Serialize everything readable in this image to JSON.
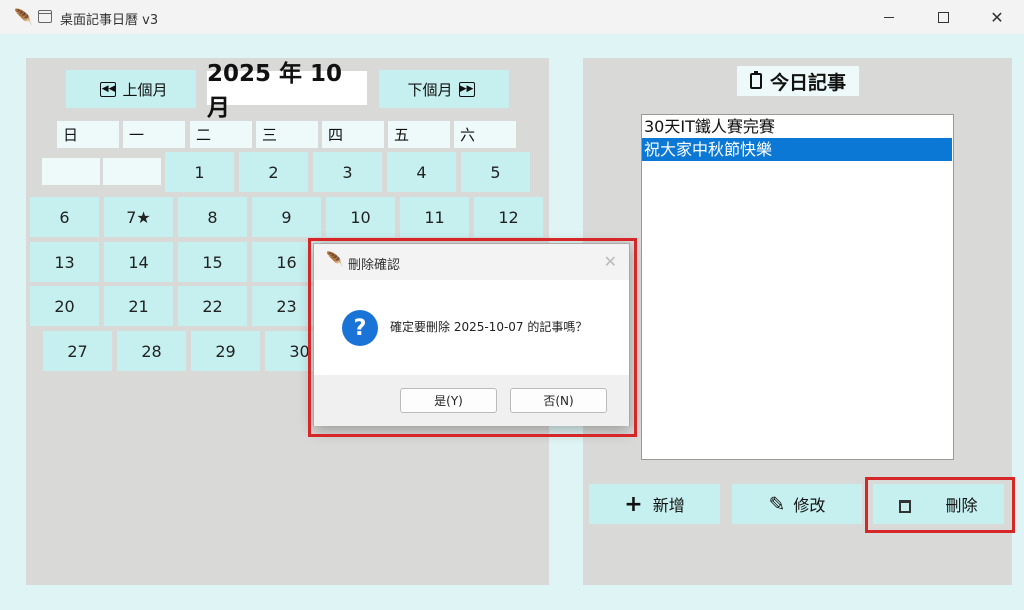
{
  "window": {
    "title": "桌面記事日曆 v3",
    "feather_icon": "feather-icon",
    "app_icon": "calendar-icon"
  },
  "calendar": {
    "prev_label": "上個月",
    "next_label": "下個月",
    "month_label": "2025 年 10 月",
    "weekdays": [
      "日",
      "一",
      "二",
      "三",
      "四",
      "五",
      "六"
    ],
    "days": [
      "1",
      "2",
      "3",
      "4",
      "5",
      "6",
      "7",
      "8",
      "9",
      "10",
      "11",
      "12",
      "13",
      "14",
      "15",
      "16",
      "20",
      "21",
      "22",
      "23",
      "27",
      "28",
      "29",
      "30"
    ],
    "marked_day": "7"
  },
  "today": {
    "title": "今日記事",
    "items": [
      "30天IT鐵人賽完賽",
      "祝大家中秋節快樂"
    ],
    "selected_index": 1
  },
  "actions": {
    "add_label": "新增",
    "edit_label": "修改",
    "delete_label": "刪除"
  },
  "dialog": {
    "title": "刪除確認",
    "message": "確定要刪除 2025-10-07 的記事嗎？",
    "yes_label": "是(Y)",
    "no_label": "否(N)",
    "question_glyph": "?"
  },
  "colors": {
    "button": "#c6f0f0",
    "panel": "#d9d9d7",
    "selection": "#0a78d4",
    "highlight": "#d62728"
  }
}
